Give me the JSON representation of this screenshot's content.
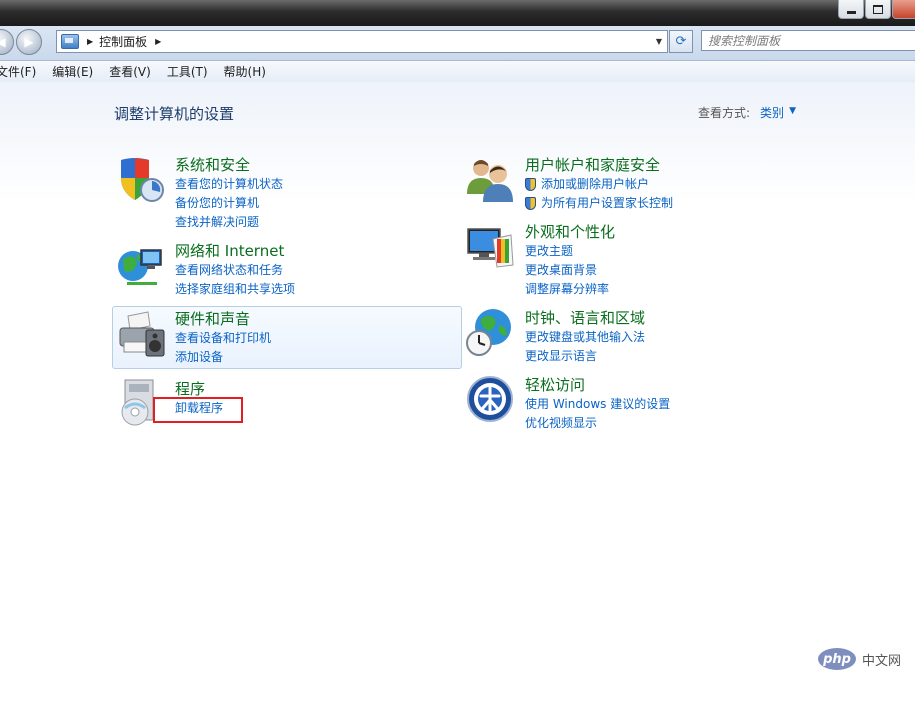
{
  "address": {
    "breadcrumb": "控制面板",
    "search_placeholder": "搜索控制面板"
  },
  "menu": [
    "文件(F)",
    "编辑(E)",
    "查看(V)",
    "工具(T)",
    "帮助(H)"
  ],
  "page": {
    "title": "调整计算机的设置",
    "view_by_label": "查看方式:",
    "view_by_value": "类别"
  },
  "categories": [
    {
      "title": "系统和安全",
      "links": [
        "查看您的计算机状态",
        "备份您的计算机",
        "查找并解决问题"
      ],
      "icon": "security-shield-icon"
    },
    {
      "title": "网络和 Internet",
      "links": [
        "查看网络状态和任务",
        "选择家庭组和共享选项"
      ],
      "icon": "network-globe-icon"
    },
    {
      "title": "硬件和声音",
      "links": [
        "查看设备和打印机",
        "添加设备"
      ],
      "icon": "printer-speaker-icon"
    },
    {
      "title": "程序",
      "links": [
        "卸载程序"
      ],
      "icon": "programs-disc-icon"
    },
    {
      "title": "用户帐户和家庭安全",
      "links": [
        "添加或删除用户帐户",
        "为所有用户设置家长控制"
      ],
      "icon": "users-icon"
    },
    {
      "title": "外观和个性化",
      "links": [
        "更改主题",
        "更改桌面背景",
        "调整屏幕分辨率"
      ],
      "icon": "monitor-palette-icon"
    },
    {
      "title": "时钟、语言和区域",
      "links": [
        "更改键盘或其他输入法",
        "更改显示语言"
      ],
      "icon": "clock-globe-icon"
    },
    {
      "title": "轻松访问",
      "links": [
        "使用 Windows 建议的设置",
        "优化视频显示"
      ],
      "icon": "ease-of-access-icon"
    }
  ],
  "watermark": {
    "badge": "php",
    "text": "中文网"
  }
}
